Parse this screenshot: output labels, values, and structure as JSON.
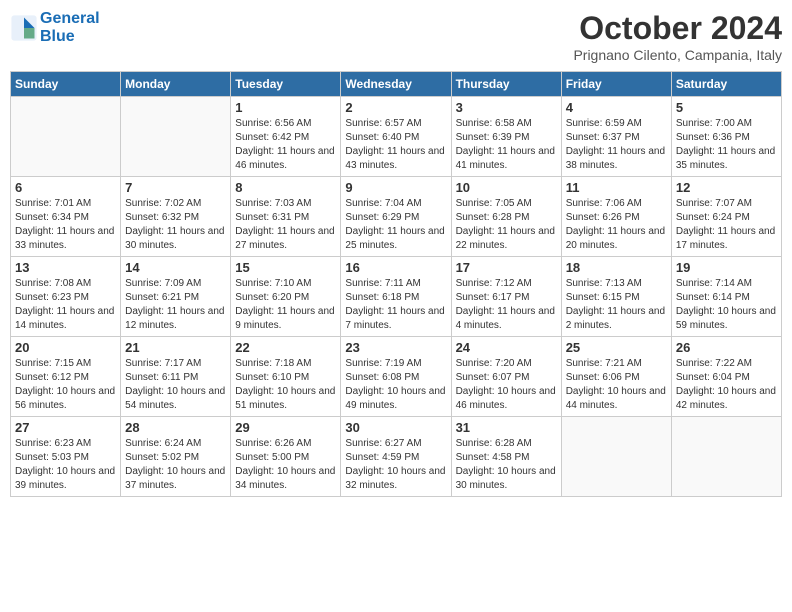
{
  "header": {
    "logo_line1": "General",
    "logo_line2": "Blue",
    "month_title": "October 2024",
    "location": "Prignano Cilento, Campania, Italy"
  },
  "weekdays": [
    "Sunday",
    "Monday",
    "Tuesday",
    "Wednesday",
    "Thursday",
    "Friday",
    "Saturday"
  ],
  "weeks": [
    [
      {
        "day": "",
        "info": ""
      },
      {
        "day": "",
        "info": ""
      },
      {
        "day": "1",
        "info": "Sunrise: 6:56 AM\nSunset: 6:42 PM\nDaylight: 11 hours and 46 minutes."
      },
      {
        "day": "2",
        "info": "Sunrise: 6:57 AM\nSunset: 6:40 PM\nDaylight: 11 hours and 43 minutes."
      },
      {
        "day": "3",
        "info": "Sunrise: 6:58 AM\nSunset: 6:39 PM\nDaylight: 11 hours and 41 minutes."
      },
      {
        "day": "4",
        "info": "Sunrise: 6:59 AM\nSunset: 6:37 PM\nDaylight: 11 hours and 38 minutes."
      },
      {
        "day": "5",
        "info": "Sunrise: 7:00 AM\nSunset: 6:36 PM\nDaylight: 11 hours and 35 minutes."
      }
    ],
    [
      {
        "day": "6",
        "info": "Sunrise: 7:01 AM\nSunset: 6:34 PM\nDaylight: 11 hours and 33 minutes."
      },
      {
        "day": "7",
        "info": "Sunrise: 7:02 AM\nSunset: 6:32 PM\nDaylight: 11 hours and 30 minutes."
      },
      {
        "day": "8",
        "info": "Sunrise: 7:03 AM\nSunset: 6:31 PM\nDaylight: 11 hours and 27 minutes."
      },
      {
        "day": "9",
        "info": "Sunrise: 7:04 AM\nSunset: 6:29 PM\nDaylight: 11 hours and 25 minutes."
      },
      {
        "day": "10",
        "info": "Sunrise: 7:05 AM\nSunset: 6:28 PM\nDaylight: 11 hours and 22 minutes."
      },
      {
        "day": "11",
        "info": "Sunrise: 7:06 AM\nSunset: 6:26 PM\nDaylight: 11 hours and 20 minutes."
      },
      {
        "day": "12",
        "info": "Sunrise: 7:07 AM\nSunset: 6:24 PM\nDaylight: 11 hours and 17 minutes."
      }
    ],
    [
      {
        "day": "13",
        "info": "Sunrise: 7:08 AM\nSunset: 6:23 PM\nDaylight: 11 hours and 14 minutes."
      },
      {
        "day": "14",
        "info": "Sunrise: 7:09 AM\nSunset: 6:21 PM\nDaylight: 11 hours and 12 minutes."
      },
      {
        "day": "15",
        "info": "Sunrise: 7:10 AM\nSunset: 6:20 PM\nDaylight: 11 hours and 9 minutes."
      },
      {
        "day": "16",
        "info": "Sunrise: 7:11 AM\nSunset: 6:18 PM\nDaylight: 11 hours and 7 minutes."
      },
      {
        "day": "17",
        "info": "Sunrise: 7:12 AM\nSunset: 6:17 PM\nDaylight: 11 hours and 4 minutes."
      },
      {
        "day": "18",
        "info": "Sunrise: 7:13 AM\nSunset: 6:15 PM\nDaylight: 11 hours and 2 minutes."
      },
      {
        "day": "19",
        "info": "Sunrise: 7:14 AM\nSunset: 6:14 PM\nDaylight: 10 hours and 59 minutes."
      }
    ],
    [
      {
        "day": "20",
        "info": "Sunrise: 7:15 AM\nSunset: 6:12 PM\nDaylight: 10 hours and 56 minutes."
      },
      {
        "day": "21",
        "info": "Sunrise: 7:17 AM\nSunset: 6:11 PM\nDaylight: 10 hours and 54 minutes."
      },
      {
        "day": "22",
        "info": "Sunrise: 7:18 AM\nSunset: 6:10 PM\nDaylight: 10 hours and 51 minutes."
      },
      {
        "day": "23",
        "info": "Sunrise: 7:19 AM\nSunset: 6:08 PM\nDaylight: 10 hours and 49 minutes."
      },
      {
        "day": "24",
        "info": "Sunrise: 7:20 AM\nSunset: 6:07 PM\nDaylight: 10 hours and 46 minutes."
      },
      {
        "day": "25",
        "info": "Sunrise: 7:21 AM\nSunset: 6:06 PM\nDaylight: 10 hours and 44 minutes."
      },
      {
        "day": "26",
        "info": "Sunrise: 7:22 AM\nSunset: 6:04 PM\nDaylight: 10 hours and 42 minutes."
      }
    ],
    [
      {
        "day": "27",
        "info": "Sunrise: 6:23 AM\nSunset: 5:03 PM\nDaylight: 10 hours and 39 minutes."
      },
      {
        "day": "28",
        "info": "Sunrise: 6:24 AM\nSunset: 5:02 PM\nDaylight: 10 hours and 37 minutes."
      },
      {
        "day": "29",
        "info": "Sunrise: 6:26 AM\nSunset: 5:00 PM\nDaylight: 10 hours and 34 minutes."
      },
      {
        "day": "30",
        "info": "Sunrise: 6:27 AM\nSunset: 4:59 PM\nDaylight: 10 hours and 32 minutes."
      },
      {
        "day": "31",
        "info": "Sunrise: 6:28 AM\nSunset: 4:58 PM\nDaylight: 10 hours and 30 minutes."
      },
      {
        "day": "",
        "info": ""
      },
      {
        "day": "",
        "info": ""
      }
    ]
  ]
}
